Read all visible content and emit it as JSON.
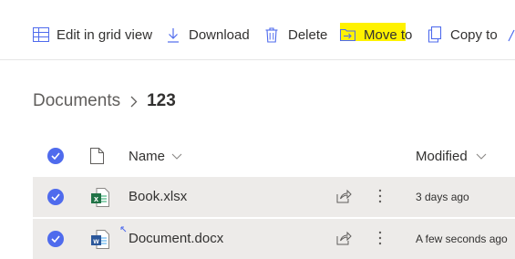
{
  "toolbar": {
    "edit_grid_label": "Edit in grid view",
    "download_label": "Download",
    "delete_label": "Delete",
    "move_to_label": "Move to",
    "copy_to_label": "Copy to"
  },
  "breadcrumb": {
    "root": "Documents",
    "current": "123"
  },
  "list": {
    "columns": {
      "name": "Name",
      "modified": "Modified"
    },
    "rows": [
      {
        "name": "Book.xlsx",
        "modified": "3 days ago",
        "type_icon": "excel-icon",
        "selected": true
      },
      {
        "name": "Document.docx",
        "modified": "A few seconds ago",
        "type_icon": "word-icon",
        "selected": true,
        "new": true
      }
    ]
  },
  "colors": {
    "accent": "#4f6bed",
    "highlight": "#fff200",
    "selected_row": "#edebe9",
    "excel": "#217346",
    "word": "#2b579a"
  }
}
